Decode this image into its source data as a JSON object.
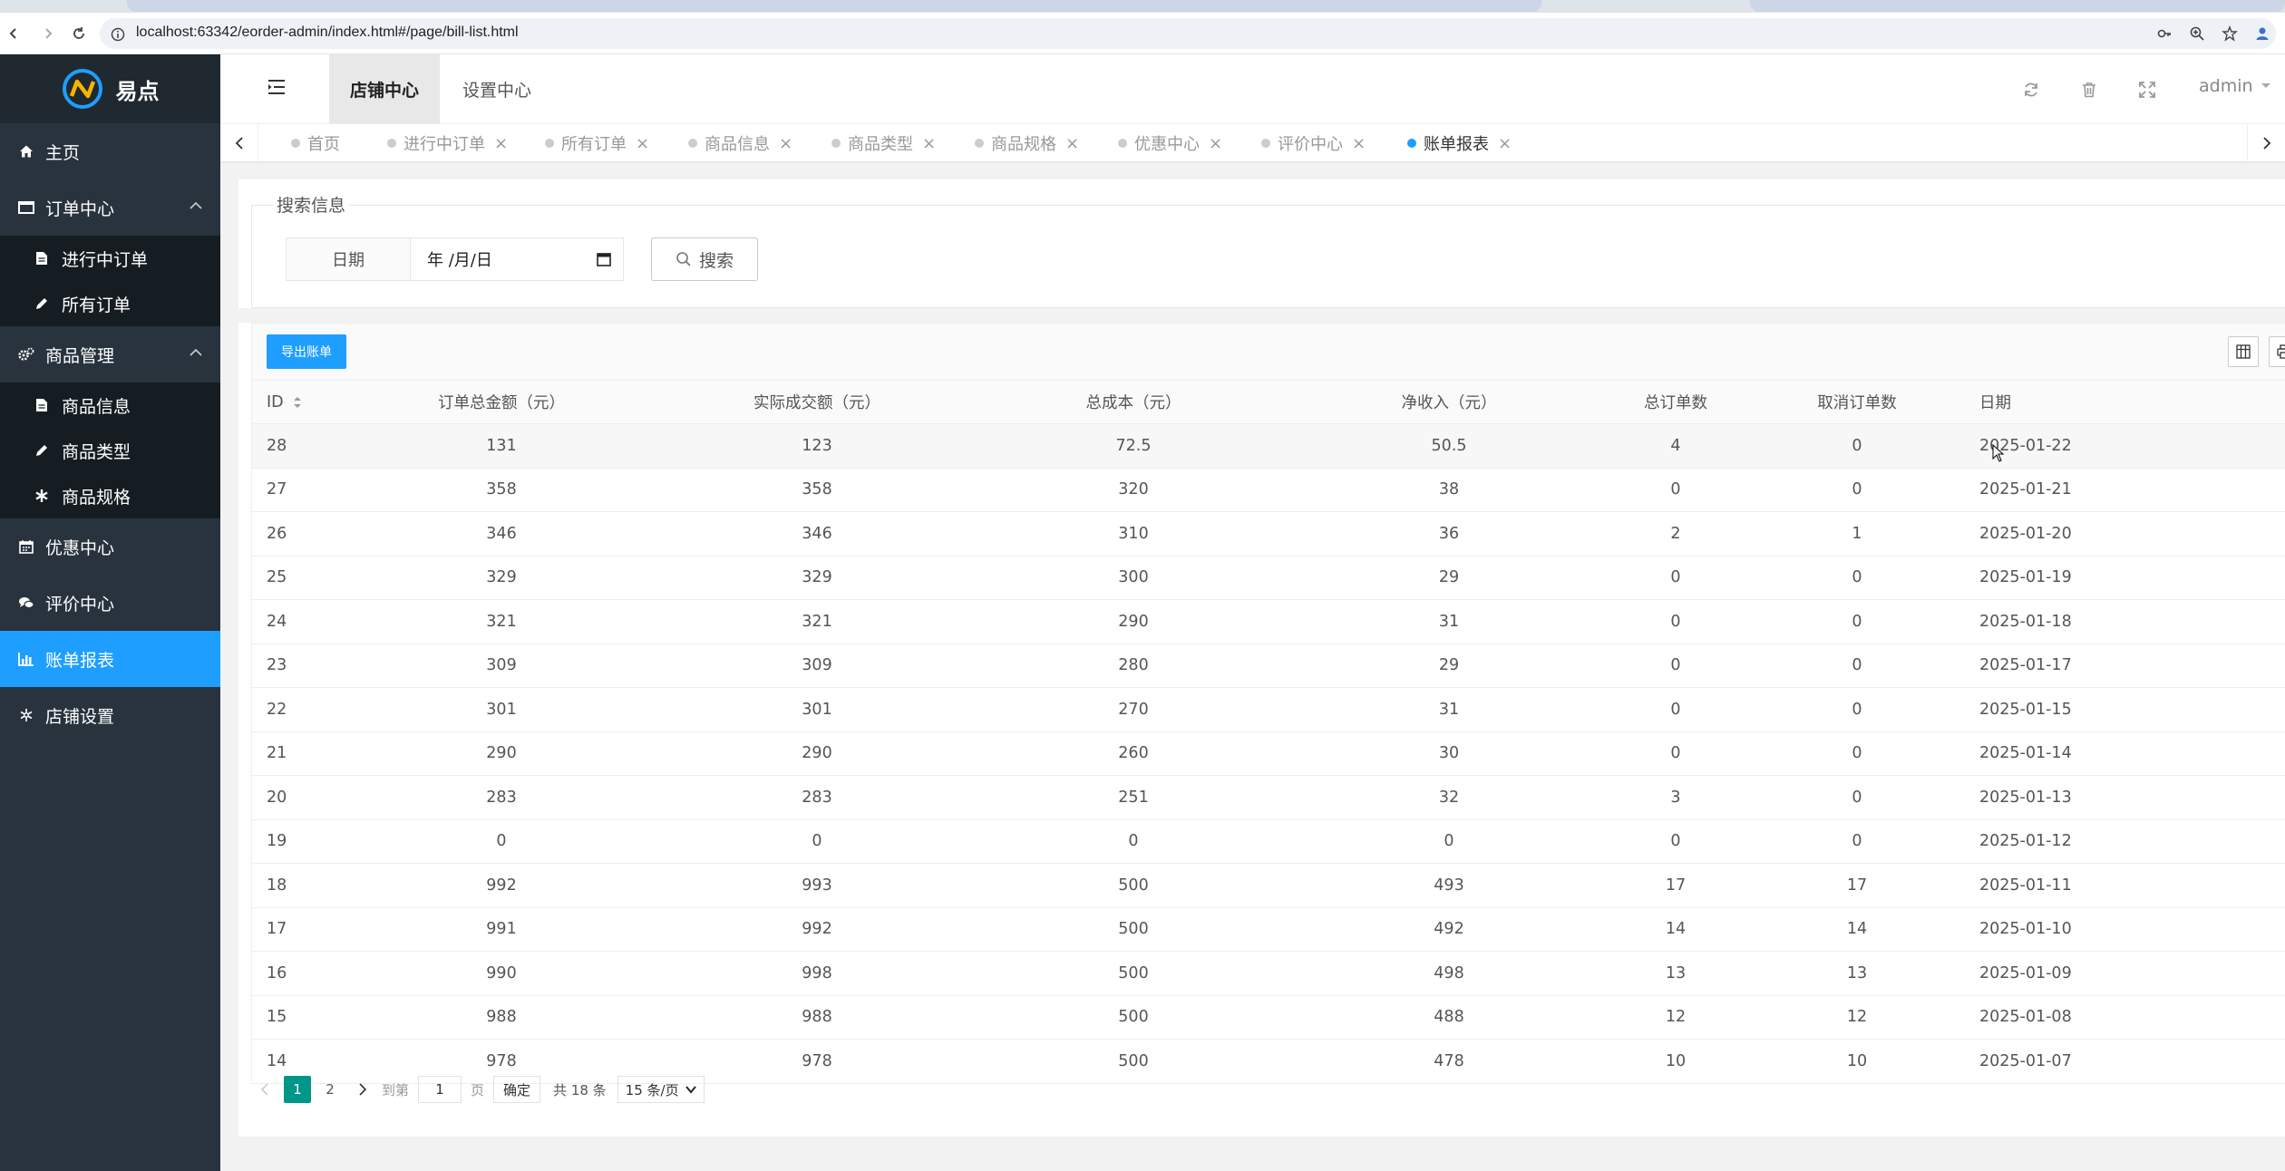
{
  "browser": {
    "url": "localhost:63342/eorder-admin/index.html#/page/bill-list.html"
  },
  "sidebar": {
    "logo_text": "易点",
    "items": [
      {
        "label": "主页"
      },
      {
        "label": "订单中心",
        "children": [
          {
            "label": "进行中订单"
          },
          {
            "label": "所有订单"
          }
        ]
      },
      {
        "label": "商品管理",
        "children": [
          {
            "label": "商品信息"
          },
          {
            "label": "商品类型"
          },
          {
            "label": "商品规格"
          }
        ]
      },
      {
        "label": "优惠中心"
      },
      {
        "label": "评价中心"
      },
      {
        "label": "账单报表"
      },
      {
        "label": "店铺设置"
      }
    ]
  },
  "header": {
    "tabs": [
      {
        "label": "店铺中心"
      },
      {
        "label": "设置中心"
      }
    ],
    "user": "admin"
  },
  "page_tabs": [
    {
      "label": "首页"
    },
    {
      "label": "进行中订单"
    },
    {
      "label": "所有订单"
    },
    {
      "label": "商品信息"
    },
    {
      "label": "商品类型"
    },
    {
      "label": "商品规格"
    },
    {
      "label": "优惠中心"
    },
    {
      "label": "评价中心"
    },
    {
      "label": "账单报表"
    }
  ],
  "search": {
    "legend": "搜索信息",
    "date_label": "日期",
    "date_placeholder": "年 /月/日",
    "search_button": "搜索"
  },
  "table": {
    "export_button": "导出账单",
    "columns": [
      "ID",
      "订单总金额（元）",
      "实际成交额（元）",
      "总成本（元）",
      "净收入（元）",
      "总订单数",
      "取消订单数",
      "日期"
    ],
    "rows": [
      [
        "28",
        "131",
        "123",
        "72.5",
        "50.5",
        "4",
        "0",
        "2025-01-22"
      ],
      [
        "27",
        "358",
        "358",
        "320",
        "38",
        "0",
        "0",
        "2025-01-21"
      ],
      [
        "26",
        "346",
        "346",
        "310",
        "36",
        "2",
        "1",
        "2025-01-20"
      ],
      [
        "25",
        "329",
        "329",
        "300",
        "29",
        "0",
        "0",
        "2025-01-19"
      ],
      [
        "24",
        "321",
        "321",
        "290",
        "31",
        "0",
        "0",
        "2025-01-18"
      ],
      [
        "23",
        "309",
        "309",
        "280",
        "29",
        "0",
        "0",
        "2025-01-17"
      ],
      [
        "22",
        "301",
        "301",
        "270",
        "31",
        "0",
        "0",
        "2025-01-15"
      ],
      [
        "21",
        "290",
        "290",
        "260",
        "30",
        "0",
        "0",
        "2025-01-14"
      ],
      [
        "20",
        "283",
        "283",
        "251",
        "32",
        "3",
        "0",
        "2025-01-13"
      ],
      [
        "19",
        "0",
        "0",
        "0",
        "0",
        "0",
        "0",
        "2025-01-12"
      ],
      [
        "18",
        "992",
        "993",
        "500",
        "493",
        "17",
        "17",
        "2025-01-11"
      ],
      [
        "17",
        "991",
        "992",
        "500",
        "492",
        "14",
        "14",
        "2025-01-10"
      ],
      [
        "16",
        "990",
        "998",
        "500",
        "498",
        "13",
        "13",
        "2025-01-09"
      ],
      [
        "15",
        "988",
        "988",
        "500",
        "488",
        "12",
        "12",
        "2025-01-08"
      ],
      [
        "14",
        "978",
        "978",
        "500",
        "478",
        "10",
        "10",
        "2025-01-07"
      ]
    ]
  },
  "pagination": {
    "pages": [
      "1",
      "2"
    ],
    "current": "1",
    "goto_label": "到第",
    "goto_value": "1",
    "page_unit": "页",
    "confirm": "确定",
    "total": "共 18 条",
    "page_size": "15 条/页"
  },
  "colors": {
    "sidebar_bg": "#28333e",
    "accent": "#1e9fff",
    "pager_active": "#009688"
  }
}
